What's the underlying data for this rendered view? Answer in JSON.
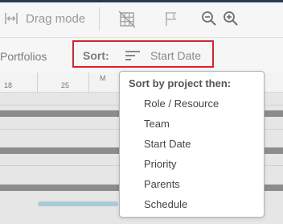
{
  "toolbar": {
    "drag_mode_label": "Drag mode",
    "icons": [
      "drag-mode-icon",
      "grid-disabled-icon",
      "flag-icon",
      "zoom-out-icon",
      "zoom-in-icon"
    ]
  },
  "filterbar": {
    "portfolios_label": "Portfolios",
    "sort_label": "Sort:",
    "sort_value": "Start Date",
    "highlight_color": "#d9222a"
  },
  "timeline": {
    "ticks": [
      "18",
      "25"
    ],
    "month_label": "M"
  },
  "sort_menu": {
    "title": "Sort by project then:",
    "items": [
      "Role / Resource",
      "Team",
      "Start Date",
      "Priority",
      "Parents",
      "Schedule"
    ]
  },
  "colors": {
    "accent_bar": "#2a3950",
    "gantt_bar": "#8c8c8c",
    "task_bar": "#a6ccd9"
  }
}
